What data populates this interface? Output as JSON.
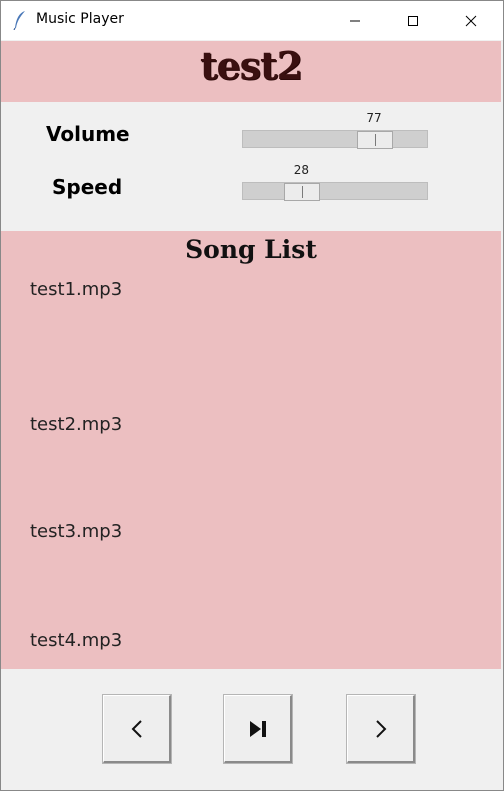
{
  "window": {
    "title": "Music Player"
  },
  "header": {
    "song_title": "test2"
  },
  "controls": {
    "volume": {
      "label": "Volume",
      "value": "77",
      "min": 0,
      "max": 100
    },
    "speed": {
      "label": "Speed",
      "value": "28",
      "min": 0,
      "max": 100
    }
  },
  "songlist": {
    "title": "Song List",
    "items": [
      "test1.mp3",
      "test2.mp3",
      "test3.mp3",
      "test4.mp3"
    ]
  },
  "colors": {
    "accent_pink": "#ecbfc1",
    "panel_gray": "#f0f0f0"
  },
  "icons": {
    "app": "feather-icon",
    "prev": "chevron-left-icon",
    "play_pause": "play-pause-icon",
    "next": "chevron-right-icon"
  }
}
